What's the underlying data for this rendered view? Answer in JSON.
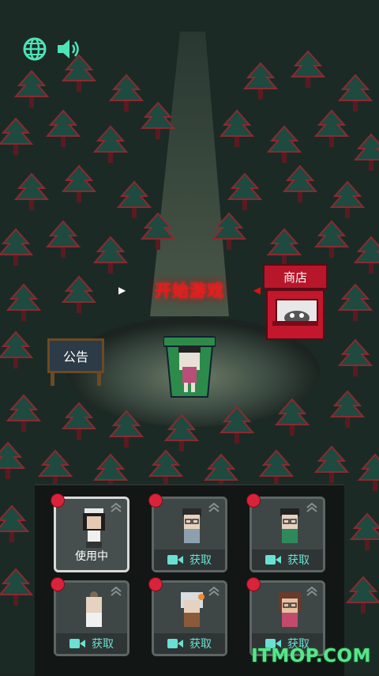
{
  "top_bar": {
    "globe_icon": "globe-icon",
    "sound_icon": "speaker-icon",
    "icon_color": "#4fe3b7"
  },
  "scene": {
    "start_label": "开始游戏",
    "notice_label": "公告",
    "shop_label": "商店",
    "glow_color": "#e41d1d"
  },
  "characters": [
    {
      "status": "使用中",
      "selected": true
    },
    {
      "status": "获取",
      "selected": false
    },
    {
      "status": "获取",
      "selected": false
    },
    {
      "status": "获取",
      "selected": false
    },
    {
      "status": "获取",
      "selected": false
    },
    {
      "status": "获取",
      "selected": false
    }
  ],
  "watermark": "ITMOP.COM"
}
